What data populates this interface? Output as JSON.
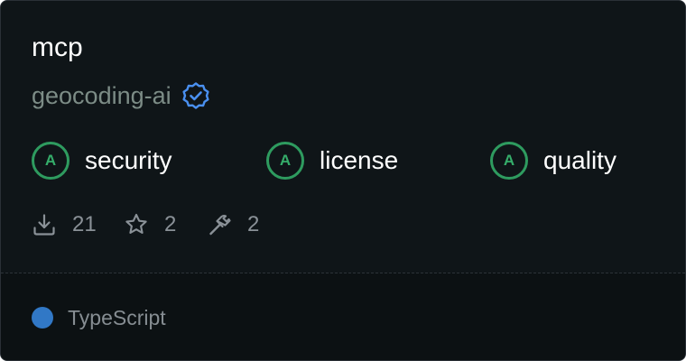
{
  "package": {
    "name": "mcp",
    "author": "geocoding-ai",
    "verified_icon": "verified-badge-icon"
  },
  "grades": [
    {
      "grade": "A",
      "label": "security"
    },
    {
      "grade": "A",
      "label": "license"
    },
    {
      "grade": "A",
      "label": "quality"
    }
  ],
  "stats": {
    "downloads": {
      "icon": "download-icon",
      "value": "21"
    },
    "stars": {
      "icon": "star-icon",
      "value": "2"
    },
    "tools": {
      "icon": "hammer-icon",
      "value": "2"
    }
  },
  "language": {
    "name": "TypeScript",
    "color": "#3178c6"
  },
  "colors": {
    "background": "#0f1518",
    "grade_accent": "#2e9b5f",
    "verified_accent": "#4a90f0"
  }
}
